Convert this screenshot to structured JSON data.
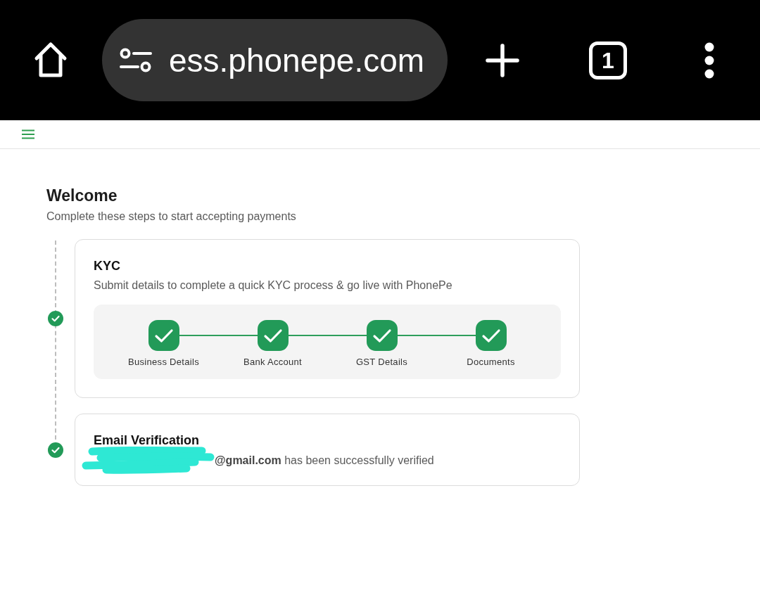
{
  "browser_bar": {
    "url": "ess.phonepe.com",
    "tab_count": "1"
  },
  "page": {
    "title": "Welcome",
    "subtitle": "Complete these steps to start accepting payments"
  },
  "steps": [
    {
      "kind": "progress",
      "title": "KYC",
      "description": "Submit details to complete a quick KYC process & go live with PhonePe",
      "completed": true,
      "substeps": [
        {
          "label": "Business Details",
          "completed": true
        },
        {
          "label": "Bank Account",
          "completed": true
        },
        {
          "label": "GST Details",
          "completed": true
        },
        {
          "label": "Documents",
          "completed": true
        }
      ]
    },
    {
      "kind": "text",
      "title": "Email Verification",
      "description": "**@gmail.com** has been successfully verified",
      "completed": true,
      "redacted": true
    }
  ]
}
